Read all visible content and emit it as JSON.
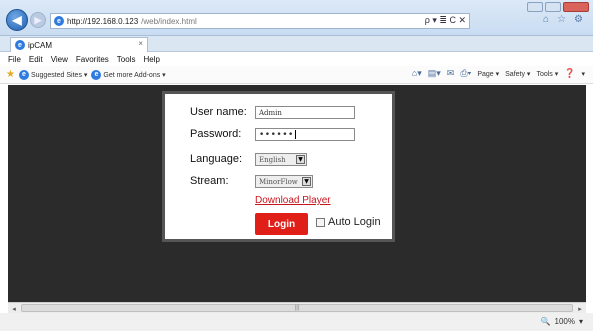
{
  "browser": {
    "url_host": "http://192.168.0.123",
    "url_path": "/web/index.html",
    "tab_title": "ipCAM",
    "tab_close": "×",
    "addr_tools": "ρ ▾ ≣ C ✕"
  },
  "menu": [
    "File",
    "Edit",
    "View",
    "Favorites",
    "Tools",
    "Help"
  ],
  "favorites": {
    "suggested": "Suggested Sites ▾",
    "addons": "Get more Add-ons ▾"
  },
  "commands": {
    "page": "Page ▾",
    "safety": "Safety ▾",
    "tools": "Tools ▾",
    "help": "▾"
  },
  "login": {
    "username_label": "User name:",
    "username_value": "Admin",
    "password_label": "Password:",
    "password_value": "••••••",
    "language_label": "Language:",
    "language_value": "English",
    "stream_label": "Stream:",
    "stream_value": "MinorFlow",
    "download_link": "Download Player",
    "login_button": "Login",
    "auto_login_label": "Auto Login"
  },
  "status": {
    "zoom": "100%",
    "zoom_arrow": "▾"
  },
  "colors": {
    "login_button": "#e02018",
    "download_link": "#c8161d",
    "content_bg": "#2b2b2b"
  }
}
